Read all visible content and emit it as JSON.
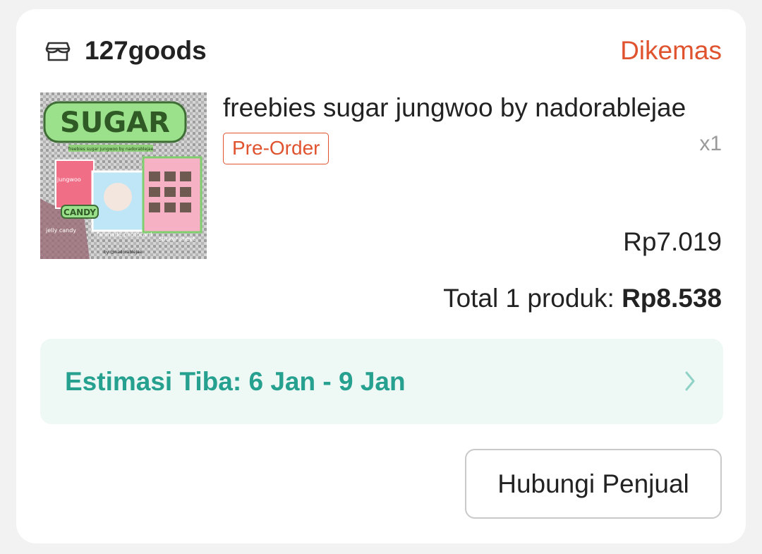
{
  "shop": {
    "name": "127goods",
    "icon": "store-icon"
  },
  "order": {
    "status": "Dikemas",
    "status_color": "#e0532f"
  },
  "product": {
    "title": "freebies sugar jungwoo by nadorablejae",
    "badge": "Pre-Order",
    "quantity": "x1",
    "price": "Rp7.019",
    "image_text": [
      "SUGAR",
      "freebies sugar jungwoo by nadorablejae",
      "jungwoo",
      "CANDY",
      "jelly candy",
      "fanmade photocard",
      "sticker sheet",
      "by @nadorablejae"
    ]
  },
  "total": {
    "label": "Total 1 produk:",
    "value": "Rp8.538"
  },
  "estimate": {
    "label": "Estimasi Tiba: 6 Jan - 9 Jan",
    "color": "#26a08f",
    "icon": "chevron-right-icon"
  },
  "actions": {
    "contact_label": "Hubungi Penjual"
  }
}
